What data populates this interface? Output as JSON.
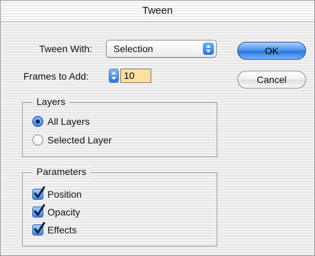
{
  "dialog": {
    "title": "Tween"
  },
  "tween_with": {
    "label": "Tween With:",
    "selected": "Selection"
  },
  "frames": {
    "label": "Frames to Add:",
    "value": "10"
  },
  "buttons": {
    "ok": "OK",
    "cancel": "Cancel"
  },
  "layers": {
    "legend": "Layers",
    "options": [
      {
        "label": "All Layers",
        "checked": true
      },
      {
        "label": "Selected Layer",
        "checked": false
      }
    ]
  },
  "parameters": {
    "legend": "Parameters",
    "items": [
      {
        "label": "Position",
        "checked": true
      },
      {
        "label": "Opacity",
        "checked": true
      },
      {
        "label": "Effects",
        "checked": true
      }
    ]
  }
}
